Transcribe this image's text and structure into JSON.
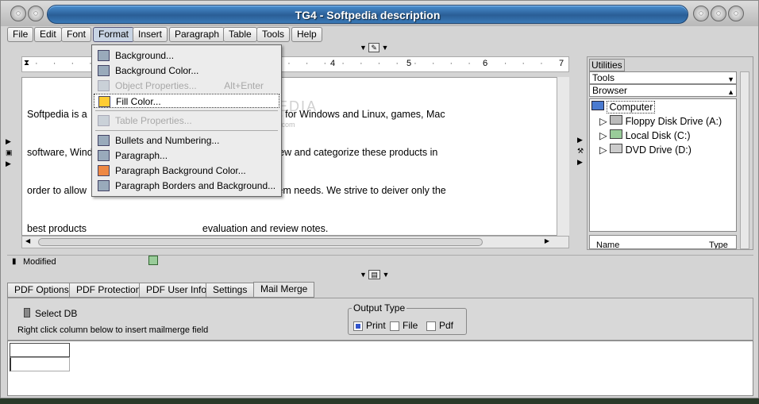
{
  "window": {
    "title": "TG4 - Softpedia description"
  },
  "menu": [
    "File",
    "Edit",
    "Font",
    "Format",
    "Insert",
    "Paragraph",
    "Table",
    "Tools",
    "Help"
  ],
  "format_menu": [
    {
      "label": "Background...",
      "disabled": false
    },
    {
      "label": "Background Color...",
      "disabled": false
    },
    {
      "label": "Object Properties...",
      "shortcut": "Alt+Enter",
      "disabled": true
    },
    {
      "label": "Fill Color...",
      "disabled": false
    },
    {
      "label": "Table Properties...",
      "disabled": true
    },
    {
      "label": "Bullets and Numbering...",
      "disabled": false
    },
    {
      "label": "Paragraph...",
      "disabled": false
    },
    {
      "label": "Paragraph Background Color...",
      "disabled": false
    },
    {
      "label": "Paragraph Borders and Background...",
      "disabled": false
    }
  ],
  "ruler": {
    "marks": [
      "4",
      "5",
      "6",
      "7"
    ]
  },
  "document": {
    "lines": [
      "Softpedia is a                                         software programs for Windows and Linux, games, Mac",
      "software, Wind                                       d articles. We review and categorize these products in",
      "order to allow                                           ey and their system needs. We strive to deiver only the",
      "best products                                          evaluation and review notes."
    ],
    "watermark": "SOFTPEDIA",
    "watermark_sub": "www.softpedia.com"
  },
  "utilities": {
    "title": "Utilities",
    "tools_combo": "Tools",
    "browser_combo": "Browser",
    "tree": [
      {
        "label": "Computer",
        "level": 0
      },
      {
        "label": "Floppy Disk Drive (A:)",
        "level": 1
      },
      {
        "label": "Local Disk (C:)",
        "level": 1
      },
      {
        "label": "DVD Drive (D:)",
        "level": 1
      }
    ],
    "columns": [
      "Name",
      "Type"
    ]
  },
  "status": {
    "text": "Modified"
  },
  "bottom_tabs": [
    "PDF Options",
    "PDF Protection",
    "PDF User Info",
    "Settings",
    "Mail Merge"
  ],
  "mailmerge": {
    "select_db": "Select DB",
    "hint": "Right click column below to insert mailmerge field",
    "output_type_label": "Output Type",
    "options": [
      "Print",
      "File",
      "Pdf"
    ],
    "selected": "Print"
  },
  "colors": {
    "title_blue": "#2a5e96",
    "menu_highlight": "#c8d4e4"
  }
}
